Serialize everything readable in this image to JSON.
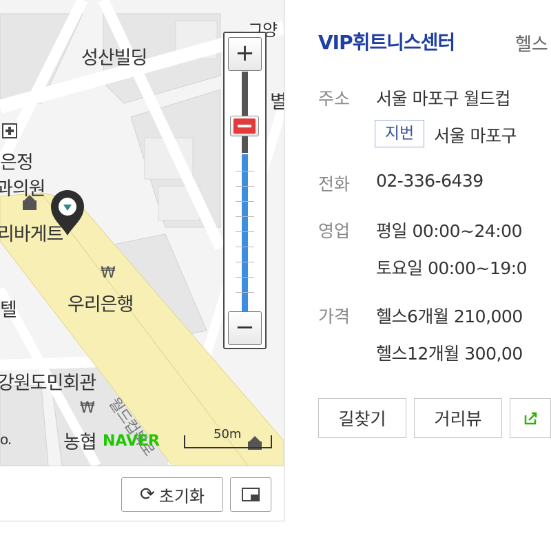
{
  "map": {
    "labels": {
      "seongsan_building": "성산빌딩",
      "top_right_partial": "그양",
      "right_edge_partial": "별",
      "clinic_line1": "은정",
      "clinic_line2": "과의원",
      "bakery": "리바게트",
      "woori_bank": "우리은행",
      "hotel_partial": "텔",
      "gangwon_hall": "강원도민회관",
      "nonghyup": "농협",
      "road_name": "월드컵북로",
      "left_partial": "o."
    },
    "bank_symbol": "₩",
    "naver_logo": "NAVER",
    "scale_label": "50m",
    "zoom": {
      "plus_label": "+",
      "minus_label": "−",
      "level_fraction": 0.28
    },
    "footer": {
      "reset_label": "초기화"
    },
    "colors": {
      "road": "#f7efb4",
      "block": "#e7e7e7",
      "street": "#ffffff",
      "zoom_blue": "#3d8ee0",
      "handle_red": "#e23b3b",
      "naver_green": "#1ec800"
    }
  },
  "place": {
    "name": "VIP휘트니스센터",
    "category": "헬스",
    "address_label": "주소",
    "address": "서울 마포구 월드컵",
    "jibun_badge": "지번",
    "jibun_address": "서울 마포구",
    "phone_label": "전화",
    "phone": "02-336-6439",
    "hours_label": "영업",
    "hours_weekday": "평일 00:00~24:00",
    "hours_saturday": "토요일 00:00~19:0",
    "price_label": "가격",
    "price_6m": "헬스6개월 210,000",
    "price_12m": "헬스12개월 300,00",
    "colors": {
      "name": "#1f3fa3",
      "label": "#888888"
    }
  },
  "actions": {
    "directions": "길찾기",
    "street_view": "거리뷰"
  }
}
